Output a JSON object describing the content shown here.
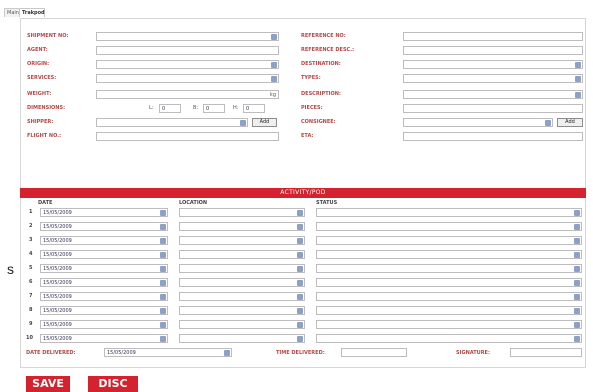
{
  "tabs": [
    {
      "label": "Main"
    },
    {
      "label": "Trakpod"
    }
  ],
  "form": {
    "left": {
      "shipment_no": "SHIPMENT NO:",
      "agent": "AGENT:",
      "origin": "ORIGIN:",
      "services": "SERVICES:",
      "weight": "WEIGHT:",
      "dimensions": "DIMENSIONS:",
      "shipper": "SHIPPER:",
      "flight_no": "FLIGHT NO.:"
    },
    "right": {
      "reference_no": "REFERENCE NO:",
      "reference_desc": "REFERENCE DESC.:",
      "destination": "DESTINATION:",
      "types": "TYPES:",
      "description": "DESCRIPTION:",
      "pieces": "PIECES:",
      "consignee": "CONSIGNEE:",
      "eta": "ETA:"
    },
    "weight_unit": "kg",
    "dim_l": "L:",
    "dim_b": "B:",
    "dim_h": "H:",
    "dim_l_val": "0",
    "dim_b_val": "0",
    "dim_h_val": "0",
    "add_label": "Add"
  },
  "activity": {
    "title": "ACTIVITY/POD",
    "headers": {
      "date": "DATE",
      "location": "LOCATION",
      "status": "STATUS"
    },
    "rows": [
      {
        "n": "1",
        "date": "15/05/2009"
      },
      {
        "n": "2",
        "date": "15/05/2009"
      },
      {
        "n": "3",
        "date": "15/05/2009"
      },
      {
        "n": "4",
        "date": "15/05/2009"
      },
      {
        "n": "5",
        "date": "15/05/2009"
      },
      {
        "n": "6",
        "date": "15/05/2009"
      },
      {
        "n": "7",
        "date": "15/05/2009"
      },
      {
        "n": "8",
        "date": "15/05/2009"
      },
      {
        "n": "9",
        "date": "15/05/2009"
      },
      {
        "n": "10",
        "date": "15/05/2009"
      }
    ]
  },
  "footer": {
    "date_delivered_label": "DATE DELIVERED:",
    "date_delivered_value": "15/05/2009",
    "time_delivered_label": "TIME DELIVERED:",
    "signature_label": "SIGNATURE:"
  },
  "actions": {
    "save": "SAVE",
    "disc": "DISC"
  },
  "stray_char": "s"
}
